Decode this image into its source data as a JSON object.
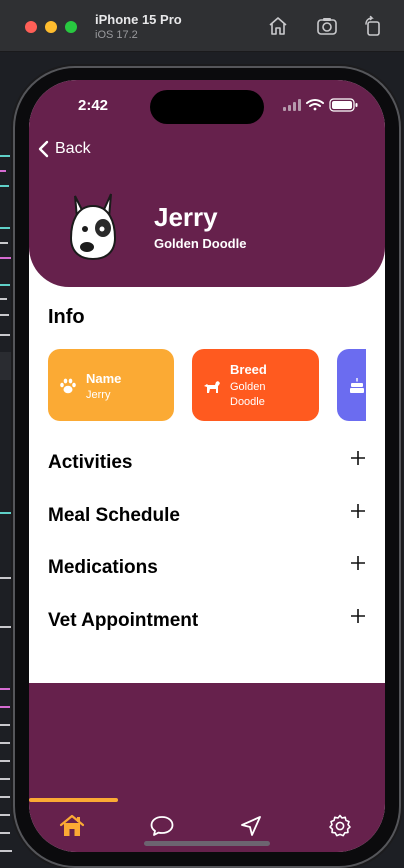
{
  "simulator": {
    "device_name": "iPhone 15 Pro",
    "os_version": "iOS 17.2"
  },
  "status_bar": {
    "time": "2:42"
  },
  "header": {
    "back_label": "Back",
    "pet_name": "Jerry",
    "pet_breed": "Golden Doodle"
  },
  "info": {
    "title": "Info",
    "cards": [
      {
        "title": "Name",
        "value": "Jerry",
        "icon": "paw-icon",
        "color": "#fbaa34"
      },
      {
        "title": "Breed",
        "value": "Golden Doodle",
        "icon": "dog-icon",
        "color": "#ff5a1f"
      },
      {
        "title": "",
        "value": "",
        "icon": "cake-icon",
        "color": "#6b6cf0"
      }
    ]
  },
  "sections": [
    {
      "label": "Activities"
    },
    {
      "label": "Meal Schedule"
    },
    {
      "label": "Medications"
    },
    {
      "label": "Vet Appointment"
    }
  ],
  "tab_bar": {
    "active": "home",
    "tabs": [
      "home-icon",
      "chat-icon",
      "navigation-icon",
      "settings-icon"
    ]
  },
  "colors": {
    "primary": "#66214c",
    "accent": "#fbaa34",
    "breed_card": "#ff5a1f",
    "birthday_card": "#6b6cf0"
  }
}
